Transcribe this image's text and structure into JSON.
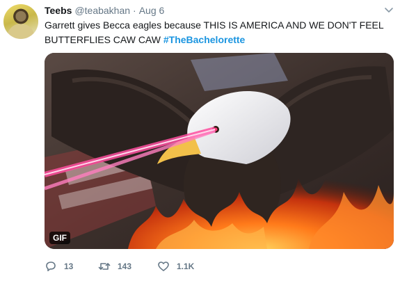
{
  "author": {
    "name": "Teebs",
    "handle": "@teabakhan",
    "separator": "·",
    "time": "Aug 6"
  },
  "tweet": {
    "text": "Garrett gives Becca eagles because THIS IS AMERICA AND WE DON'T FEEL BUTTERFLIES CAW CAW",
    "hashtag": "#TheBachelorette"
  },
  "media": {
    "badge": "GIF"
  },
  "actions": {
    "replies": "13",
    "retweets": "143",
    "likes": "1.1K"
  },
  "icons": {
    "reply": "reply-icon",
    "retweet": "retweet-icon",
    "like": "heart-icon",
    "more": "chevron-down-icon"
  },
  "colors": {
    "hashtag": "#1b95e0",
    "muted": "#657786",
    "text": "#14171a"
  }
}
